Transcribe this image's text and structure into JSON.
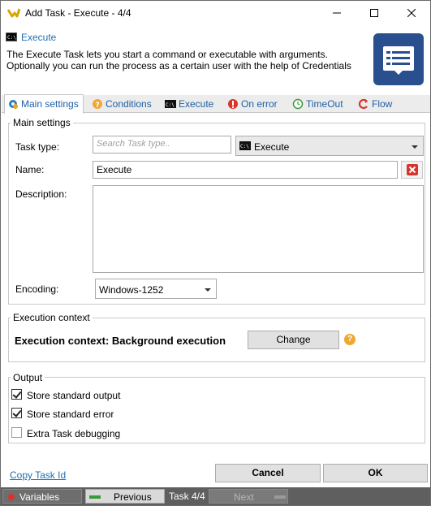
{
  "window": {
    "title": "Add Task - Execute - 4/4",
    "minimize_symbol": "—",
    "maximize_symbol": "☐",
    "close_symbol": "✕"
  },
  "header": {
    "task_name": "Execute",
    "description": "The Execute Task lets you start a command or executable with arguments. Optionally you can run the process as a certain user with the help of Credentials",
    "big_icon": "document-book-icon"
  },
  "tabs": [
    {
      "label": "Main settings",
      "icon": "gear-icon",
      "active": true
    },
    {
      "label": "Conditions",
      "icon": "question-icon",
      "active": false
    },
    {
      "label": "Execute",
      "icon": "console-icon",
      "active": false
    },
    {
      "label": "On error",
      "icon": "error-icon",
      "active": false
    },
    {
      "label": "TimeOut",
      "icon": "clock-arrow-icon",
      "active": false
    },
    {
      "label": "Flow",
      "icon": "flow-icon",
      "active": false
    }
  ],
  "main_settings": {
    "legend": "Main settings",
    "task_type_label": "Task type:",
    "search_placeholder": "Search Task type..",
    "task_type_value": "Execute",
    "name_label": "Name:",
    "name_value": "Execute",
    "description_label": "Description:",
    "description_value": "",
    "encoding_label": "Encoding:",
    "encoding_value": "Windows-1252"
  },
  "execution_context": {
    "legend": "Execution context",
    "text": "Execution context: Background execution",
    "change_label": "Change",
    "help_symbol": "?"
  },
  "output": {
    "legend": "Output",
    "options": [
      {
        "label": "Store standard output",
        "checked": true
      },
      {
        "label": "Store standard error",
        "checked": true
      },
      {
        "label": "Extra Task debugging",
        "checked": false
      }
    ]
  },
  "footer": {
    "copy_link": "Copy Task Id",
    "cancel_label": "Cancel",
    "ok_label": "OK"
  },
  "statusbar": {
    "variables_label": "Variables",
    "previous_label": "Previous",
    "task_counter": "Task 4/4",
    "next_label": "Next"
  },
  "colors": {
    "accent": "#1f6fb2",
    "big_icon_bg": "#2a4f8f",
    "statusbar_bg": "#5f5f5f"
  }
}
